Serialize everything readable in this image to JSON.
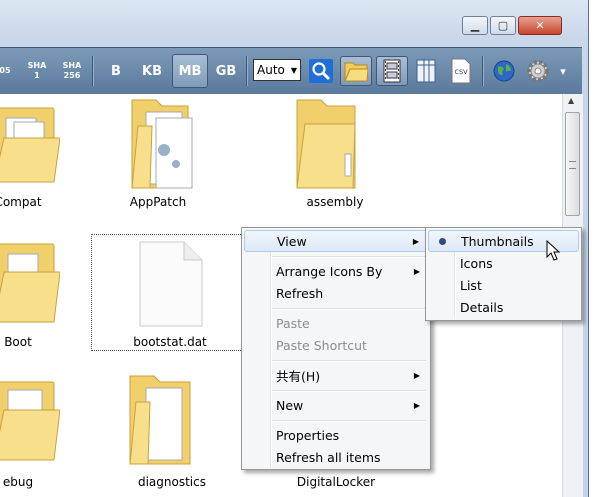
{
  "window": {
    "minimize_glyph": "▁",
    "maximize_glyph": "▢",
    "close_glyph": "✕"
  },
  "toolbar": {
    "hash_buttons": [
      {
        "line1": "05",
        "line2": ""
      },
      {
        "line1": "SHA",
        "line2": "1"
      },
      {
        "line1": "SHA",
        "line2": "256"
      }
    ],
    "unit_buttons": [
      "B",
      "KB",
      "MB",
      "GB"
    ],
    "active_unit": "MB",
    "size_mode": {
      "value": "Auto",
      "arrow": "▼"
    },
    "icons": [
      "search-icon",
      "folder-view-icon",
      "film-strip-icon",
      "columns-icon",
      "csv-export-icon",
      "globe-icon",
      "gear-icon",
      "dropdown-arrow-icon"
    ],
    "csv_label": "CSV",
    "more_arrow": "▾",
    "colors": {
      "bar_top": "#7c9ab8",
      "bar_bottom": "#5b7a9c",
      "active_bg": "#9cb3cf"
    }
  },
  "files": [
    {
      "name": "Compat",
      "type": "folder"
    },
    {
      "name": "AppPatch",
      "type": "folder"
    },
    {
      "name": "assembly",
      "type": "folder"
    },
    {
      "name": "Boot",
      "type": "folder"
    },
    {
      "name": "bootstat.dat",
      "type": "file"
    },
    {
      "name": "ebug",
      "type": "folder"
    },
    {
      "name": "diagnostics",
      "type": "folder"
    },
    {
      "name": "DigitalLocker",
      "type": "folder"
    }
  ],
  "context_menu": {
    "items": [
      {
        "label": "View",
        "submenu": true,
        "highlighted": true
      },
      {
        "label": "Arrange Icons By",
        "submenu": true
      },
      {
        "label": "Refresh"
      },
      {
        "label": "Paste",
        "disabled": true
      },
      {
        "label": "Paste Shortcut",
        "disabled": true
      },
      {
        "label": "共有(H)",
        "submenu": true
      },
      {
        "label": "New",
        "submenu": true
      },
      {
        "label": "Properties"
      },
      {
        "label": "Refresh all items"
      }
    ],
    "submenu_arrow": "▶"
  },
  "view_submenu": {
    "items": [
      {
        "label": "Thumbnails",
        "selected": true
      },
      {
        "label": "Icons"
      },
      {
        "label": "List"
      },
      {
        "label": "Details"
      }
    ]
  },
  "scrollbar": {
    "up_arrow": "▲",
    "position": 0.0
  }
}
